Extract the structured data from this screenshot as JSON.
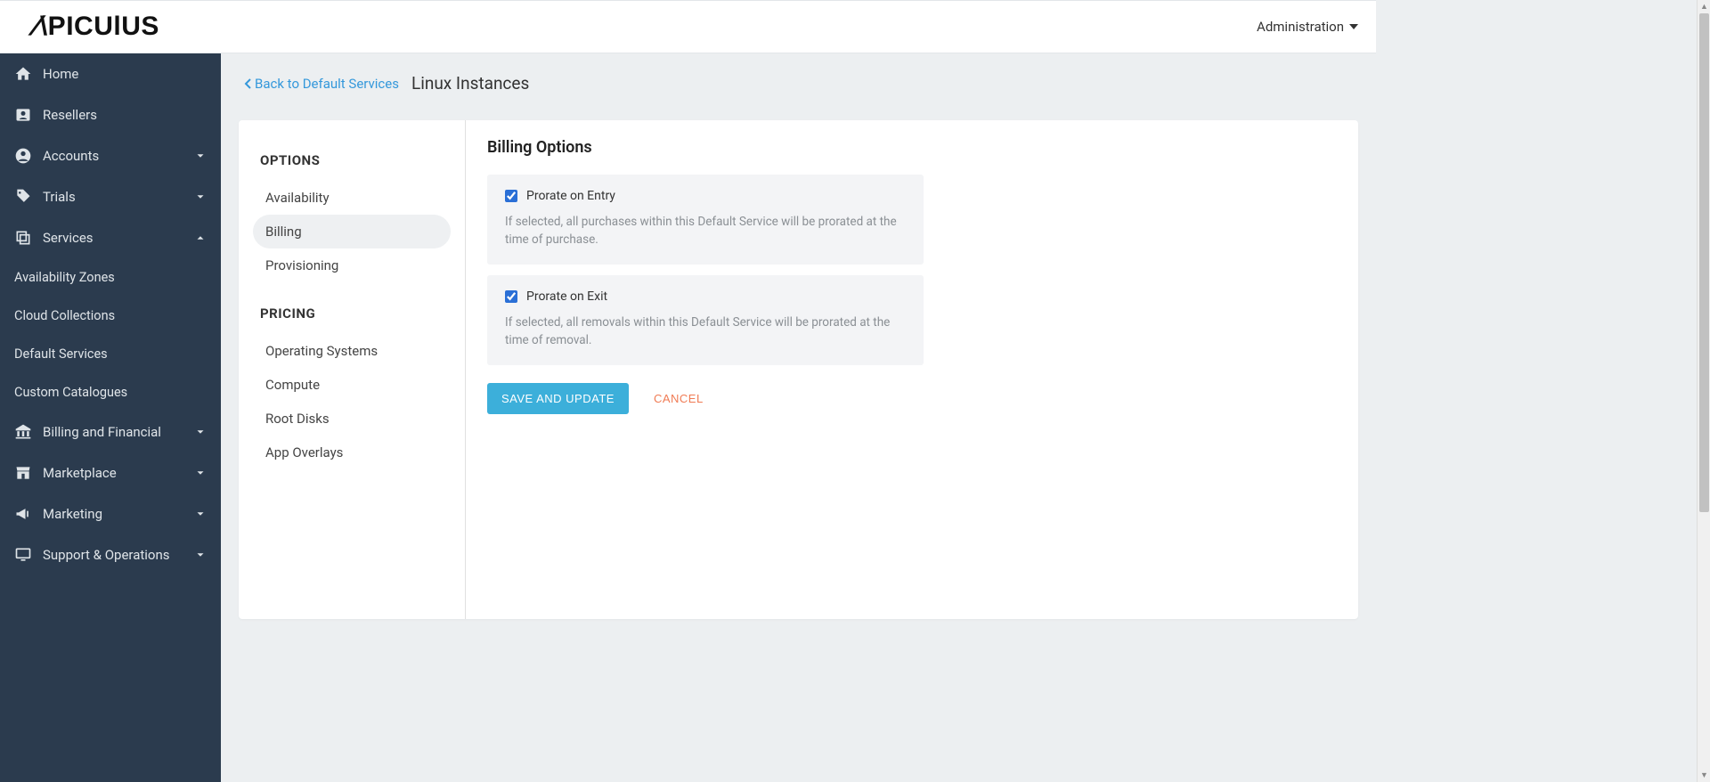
{
  "brand": "APICULUS",
  "header": {
    "admin_label": "Administration"
  },
  "sidebar": {
    "home": "Home",
    "resellers": "Resellers",
    "accounts": "Accounts",
    "trials": "Trials",
    "services": "Services",
    "services_sub": {
      "avail_zones": "Availability Zones",
      "cloud_collections": "Cloud Collections",
      "default_services": "Default Services",
      "custom_catalogues": "Custom Catalogues"
    },
    "billing_financial": "Billing and Financial",
    "marketplace": "Marketplace",
    "marketing": "Marketing",
    "support_ops": "Support & Operations"
  },
  "breadcrumb": {
    "back": "Back to Default Services",
    "title": "Linux Instances"
  },
  "left_panel": {
    "options_title": "OPTIONS",
    "options": {
      "availability": "Availability",
      "billing": "Billing",
      "provisioning": "Provisioning"
    },
    "pricing_title": "PRICING",
    "pricing": {
      "os": "Operating Systems",
      "compute": "Compute",
      "root_disks": "Root Disks",
      "app_overlays": "App Overlays"
    }
  },
  "right_panel": {
    "title": "Billing Options",
    "prorate_entry": {
      "label": "Prorate on Entry",
      "desc": "If selected, all purchases within this Default Service will be prorated at the time of purchase."
    },
    "prorate_exit": {
      "label": "Prorate on Exit",
      "desc": "If selected, all removals within this Default Service will be prorated at the time of removal."
    },
    "save": "SAVE AND UPDATE",
    "cancel": "CANCEL"
  }
}
